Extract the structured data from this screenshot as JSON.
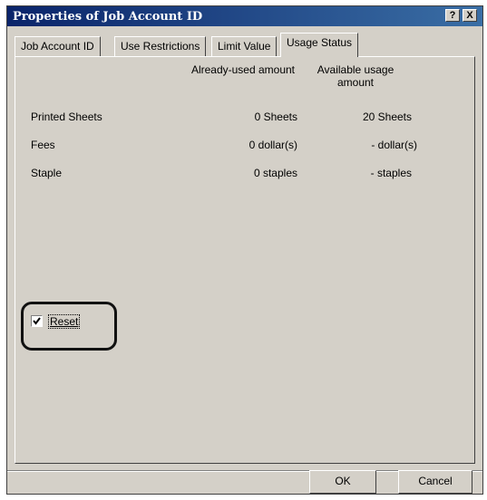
{
  "window": {
    "title": "Properties of Job Account ID",
    "help_label": "?",
    "close_label": "X"
  },
  "tabs": [
    {
      "label": "Job Account ID",
      "active": false
    },
    {
      "label": "Use Restrictions",
      "active": false
    },
    {
      "label": "Limit Value",
      "active": false
    },
    {
      "label": "Usage Status",
      "active": true
    }
  ],
  "columns": {
    "used": "Already-used amount",
    "available": "Available usage amount"
  },
  "rows": [
    {
      "label": "Printed Sheets",
      "used": "0 Sheets",
      "available": "20 Sheets"
    },
    {
      "label": "Fees",
      "used": "0 dollar(s)",
      "available": "- dollar(s)"
    },
    {
      "label": "Staple",
      "used": "0 staples",
      "available": "- staples"
    }
  ],
  "reset": {
    "label": "Reset",
    "checked": true
  },
  "buttons": {
    "ok": "OK",
    "cancel": "Cancel"
  }
}
